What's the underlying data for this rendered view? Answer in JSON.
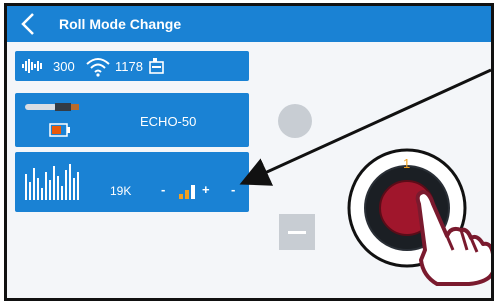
{
  "header": {
    "title": "Roll Mode Change"
  },
  "status": {
    "signal_value": "300",
    "wifi_value": "1178"
  },
  "device": {
    "name": "ECHO-50"
  },
  "frequency": {
    "value": "19K",
    "minus": "-",
    "plus": "+",
    "trailing": "-"
  },
  "dial": {
    "marker": "1"
  },
  "colors": {
    "accent": "#1a82d4",
    "dial_red": "#a0162c",
    "hand": "#7a1a2e"
  }
}
